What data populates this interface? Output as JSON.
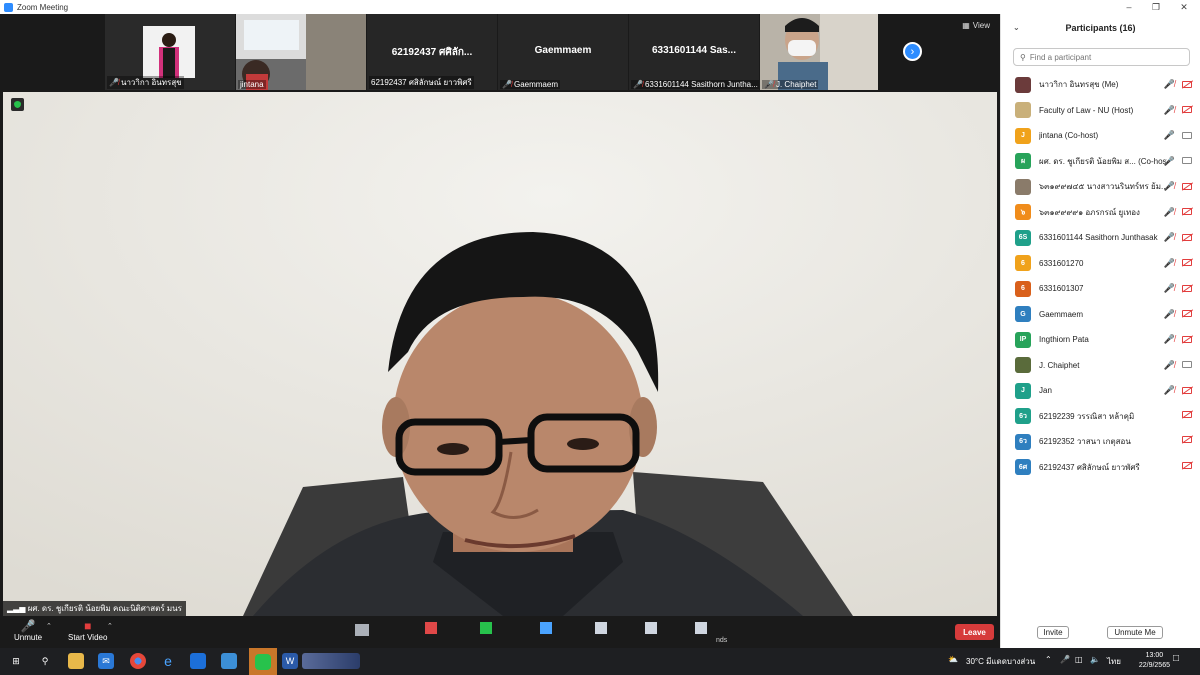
{
  "window": {
    "title": "Zoom Meeting"
  },
  "strip": {
    "thumbnails": [
      {
        "caption": "นาวาิกา อินทรสุข",
        "muted": true
      },
      {
        "caption": "jintana",
        "muted": false
      },
      {
        "center": "62192437 ศศิลัก...",
        "caption": "62192437 ศสิลักษณ์ ยาวพิศรี",
        "muted": false
      },
      {
        "center": "Gaemmaem",
        "caption": "Gaemmaem",
        "muted": true
      },
      {
        "center": "6331601144 Sas...",
        "caption": "6331601144 Sasithorn Juntha...",
        "muted": true
      },
      {
        "caption": "J. Chaiphet",
        "muted": true
      }
    ],
    "view_label": "View"
  },
  "speaker": {
    "label": "ผศ. ดร. ชูเกียรติ น้อยพิม คณะนิติศาสตร์ มนร"
  },
  "toolbar": {
    "unmute_label": "Unmute",
    "start_video_label": "Start Video",
    "leave_label": "Leave",
    "partial_label": "nds"
  },
  "panel": {
    "title": "Participants (16)",
    "search_placeholder": "Find a participant",
    "participants": [
      {
        "name": "นาวาิกา อินทรสุข (Me)",
        "avatar": "",
        "color": "#6b3b3b",
        "mic": "off",
        "cam": "off"
      },
      {
        "name": "Faculty of Law - NU (Host)",
        "avatar": "",
        "color": "#c9b07a",
        "mic": "off",
        "cam": "off"
      },
      {
        "name": "jintana (Co-host)",
        "avatar": "J",
        "color": "#f0a21b",
        "mic": "on",
        "cam": "on"
      },
      {
        "name": "ผศ. ดร. ชูเกียรติ น้อยพิม ส... (Co-host)",
        "avatar": "ผ",
        "color": "#27a35a",
        "mic": "on",
        "cam": "on"
      },
      {
        "name": "๖๓๑๙๙๗๔๕ นางสาวนรินทร์ทร ย้ม...",
        "avatar": "",
        "color": "#8a7b6a",
        "mic": "off",
        "cam": "off"
      },
      {
        "name": "๖๓๑๙๙๙๙๑ อภรกรณ์ ยูเทอง",
        "avatar": "๖",
        "color": "#f08c1b",
        "mic": "off",
        "cam": "off"
      },
      {
        "name": "6331601144 Sasithorn Junthasak",
        "avatar": "6S",
        "color": "#1fa08a",
        "mic": "off",
        "cam": "off"
      },
      {
        "name": "6331601270",
        "avatar": "6",
        "color": "#f0a21b",
        "mic": "off",
        "cam": "off"
      },
      {
        "name": "6331601307",
        "avatar": "6",
        "color": "#d9601b",
        "mic": "off",
        "cam": "off"
      },
      {
        "name": "Gaemmaem",
        "avatar": "G",
        "color": "#2f7fbf",
        "mic": "off",
        "cam": "off"
      },
      {
        "name": "Ingthiorn Pata",
        "avatar": "IP",
        "color": "#27a35a",
        "mic": "off",
        "cam": "off"
      },
      {
        "name": "J. Chaiphet",
        "avatar": "",
        "color": "#5a6b3b",
        "mic": "off",
        "cam": "on"
      },
      {
        "name": "Jan",
        "avatar": "J",
        "color": "#1fa08a",
        "mic": "off",
        "cam": "off"
      },
      {
        "name": "62192239 วรรณิสา หล้าคุมิ",
        "avatar": "6ว",
        "color": "#1fa08a",
        "mic": "none",
        "cam": "off"
      },
      {
        "name": "62192352 วาสนา เกตุสอน",
        "avatar": "6ว",
        "color": "#2f7fbf",
        "mic": "none",
        "cam": "off"
      },
      {
        "name": "62192437 ศสิลักษณ์ ยาวพัศรี",
        "avatar": "6ศ",
        "color": "#2f7fbf",
        "mic": "none",
        "cam": "off"
      }
    ],
    "invite_label": "Invite",
    "unmute_me_label": "Unmute Me"
  },
  "taskbar": {
    "weather": "30°C  มีแดดบางส่วน",
    "lang": "ไทย",
    "time": "13:00",
    "date": "22/9/2565"
  },
  "colors": {
    "accent": "#2d8cff",
    "leave": "#d63b3b",
    "muted": "#e23d3d"
  }
}
